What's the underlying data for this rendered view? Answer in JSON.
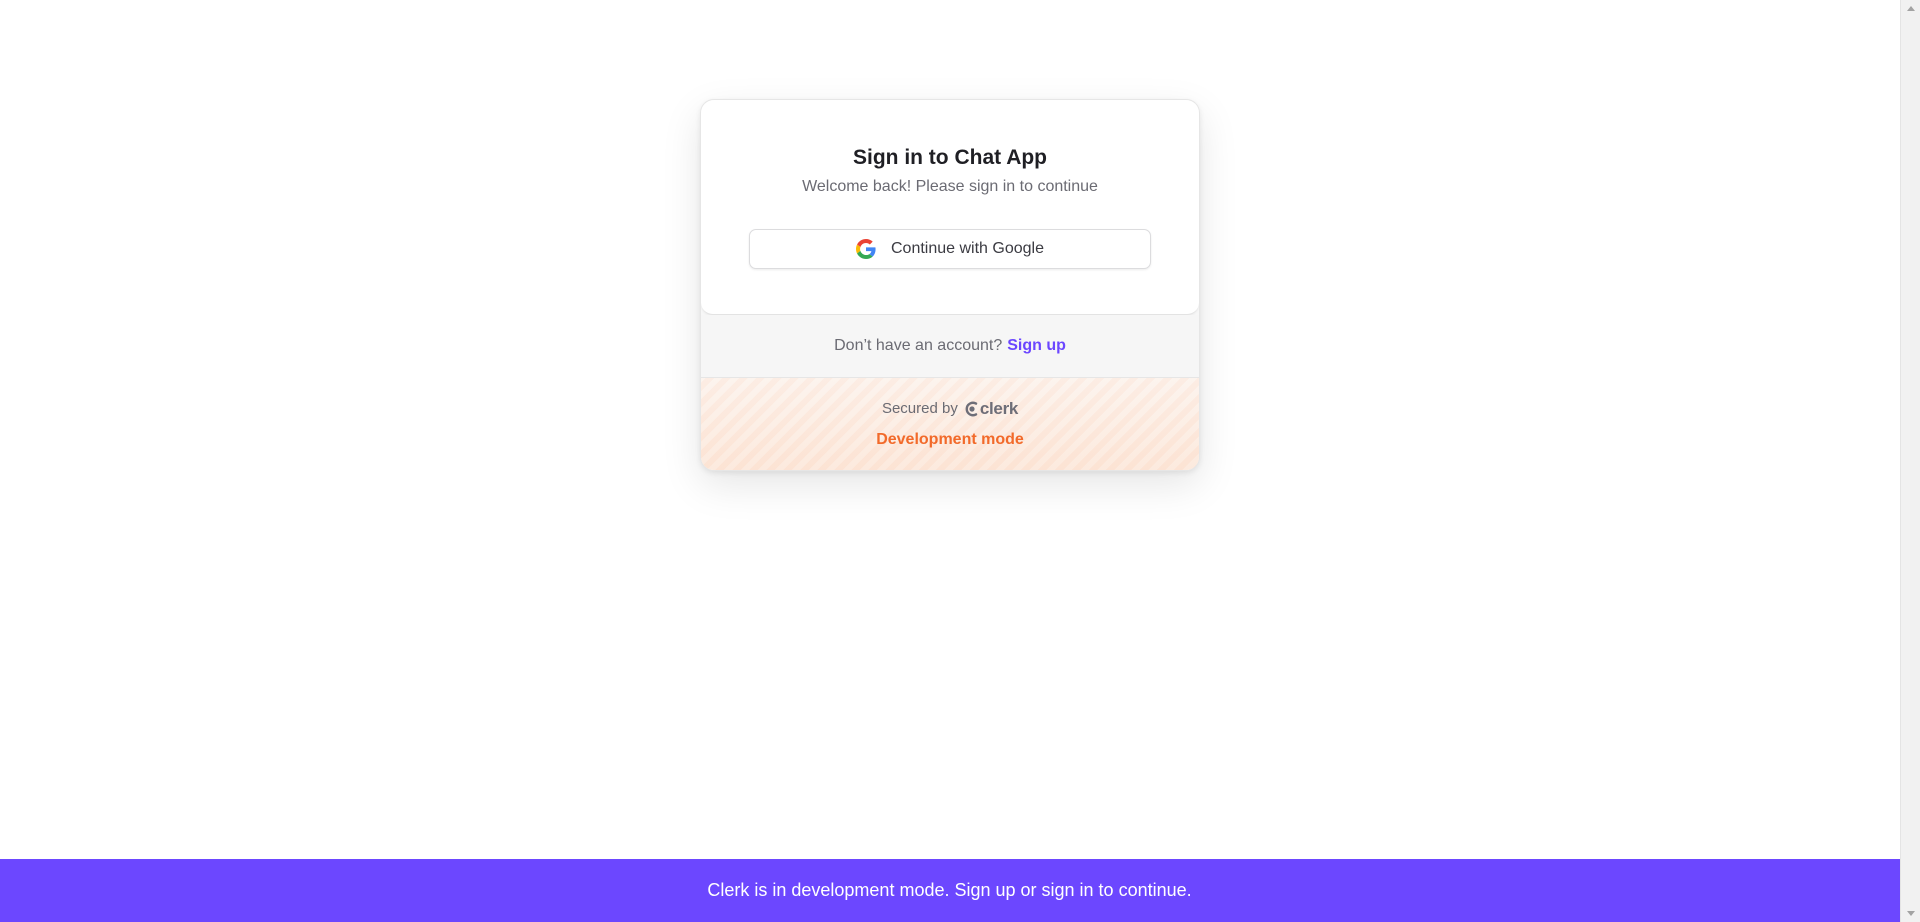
{
  "card": {
    "title": "Sign in to Chat App",
    "subtitle": "Welcome back! Please sign in to continue",
    "google_button_label": "Continue with Google",
    "google_icon": "google-icon",
    "signup_prompt": "Don’t have an account?",
    "signup_link": "Sign up",
    "secured_by": "Secured by",
    "clerk_brand": "clerk",
    "dev_mode_label": "Development mode"
  },
  "banner": {
    "text": "Clerk is in development mode. Sign up or sign in to continue."
  },
  "colors": {
    "accent": "#6c47ff",
    "dev_mode": "#f26a2a",
    "title": "#1f1f24",
    "muted": "#6b6b73"
  }
}
